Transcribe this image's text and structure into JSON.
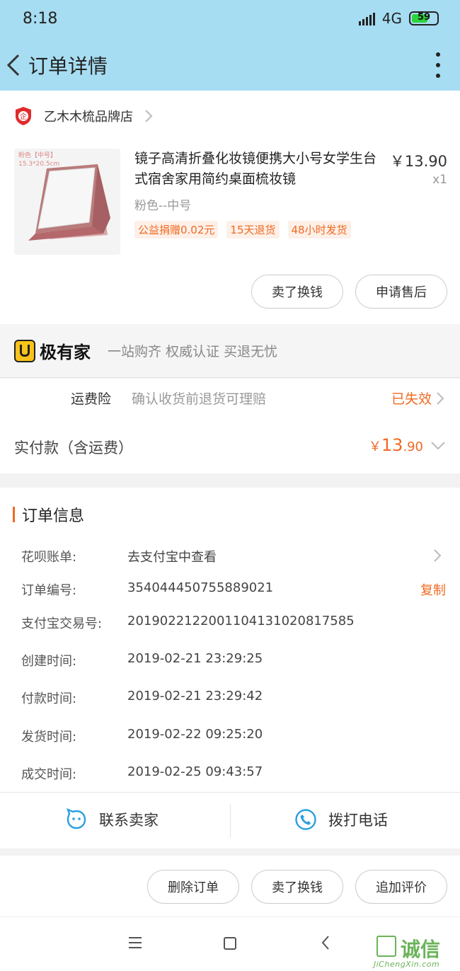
{
  "status_bar": {
    "time": "8:18",
    "network": "4G",
    "battery": "59"
  },
  "header": {
    "title": "订单详情"
  },
  "shop": {
    "name": "乙木木梳品牌店"
  },
  "product": {
    "image_tag": "粉色【中号】",
    "image_size": "15.3*20.5cm",
    "title": "镜子高清折叠化妆镜便携大小号女学生台式宿舍家用简约桌面梳妆镜",
    "price": "￥13.90",
    "quantity": "x1",
    "sku": "粉色--中号",
    "tags": [
      "公益捐赠0.02元",
      "15天退货",
      "48小时发货"
    ]
  },
  "item_actions": {
    "sell": "卖了换钱",
    "after_sale": "申请售后"
  },
  "jiyoujia": {
    "brand": "极有家",
    "slogan": "一站购齐 权威认证 买退无忧"
  },
  "insurance": {
    "label": "运费险",
    "desc": "确认收货前退货可理赔",
    "status": "已失效"
  },
  "payment": {
    "label": "实付款（含运费）",
    "currency": "￥",
    "amount_int": "13",
    "amount_dec": ".90"
  },
  "order_info": {
    "heading": "订单信息",
    "huabei": {
      "key": "花呗账单:",
      "value": "去支付宝中查看"
    },
    "order_no": {
      "key": "订单编号:",
      "value": "354044450755889021",
      "action": "复制"
    },
    "alipay_no": {
      "key": "支付宝交易号:",
      "value": "2019022122001104131020817585"
    },
    "created": {
      "key": "创建时间:",
      "value": "2019-02-21 23:29:25"
    },
    "paid": {
      "key": "付款时间:",
      "value": "2019-02-21 23:29:42"
    },
    "shipped": {
      "key": "发货时间:",
      "value": "2019-02-22 09:25:20"
    },
    "closed": {
      "key": "成交时间:",
      "value": "2019-02-25 09:43:57"
    }
  },
  "contact": {
    "seller": "联系卖家",
    "phone": "拨打电话"
  },
  "bottom_actions": {
    "delete": "删除订单",
    "sell": "卖了换钱",
    "review": "追加评价"
  },
  "watermark": {
    "text": "诚信",
    "url": "JiChengXin.com"
  },
  "colors": {
    "header_bg": "#a6ddf2",
    "accent": "#f06a22",
    "contact_blue": "#2a9fe0"
  }
}
